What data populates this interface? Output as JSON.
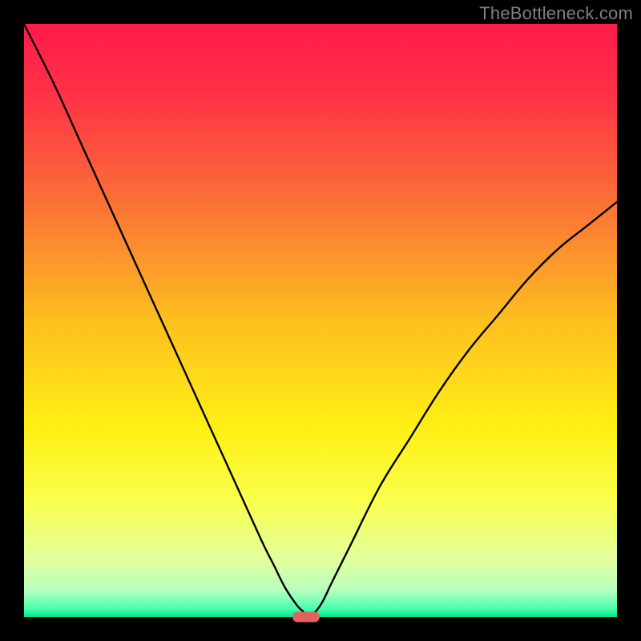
{
  "watermark": "TheBottleneck.com",
  "chart_data": {
    "type": "line",
    "title": "",
    "xlabel": "",
    "ylabel": "",
    "xlim": [
      0,
      100
    ],
    "ylim": [
      0,
      100
    ],
    "grid": false,
    "legend": false,
    "series": [
      {
        "name": "curve",
        "x": [
          0,
          5,
          10,
          15,
          20,
          25,
          30,
          35,
          40,
          42,
          44,
          46,
          47,
          48,
          50,
          52,
          55,
          60,
          65,
          70,
          75,
          80,
          85,
          90,
          95,
          100
        ],
        "values": [
          100,
          90,
          79,
          68,
          57,
          46,
          35,
          24,
          13,
          9,
          5,
          2,
          1,
          0,
          2,
          6,
          12,
          22,
          30,
          38,
          45,
          51,
          57,
          62,
          66,
          70
        ]
      }
    ],
    "marker": {
      "x": 47.5,
      "y": 0
    },
    "gradient_stops": [
      {
        "offset": 0.0,
        "color": "#ff1b4b"
      },
      {
        "offset": 0.12,
        "color": "#ff3246"
      },
      {
        "offset": 0.3,
        "color": "#fb7037"
      },
      {
        "offset": 0.5,
        "color": "#fdbf1f"
      },
      {
        "offset": 0.68,
        "color": "#ffef14"
      },
      {
        "offset": 0.8,
        "color": "#faff4a"
      },
      {
        "offset": 0.9,
        "color": "#e4ff9a"
      },
      {
        "offset": 0.955,
        "color": "#b7ffbf"
      },
      {
        "offset": 0.985,
        "color": "#4dffb0"
      },
      {
        "offset": 1.0,
        "color": "#00e78a"
      }
    ]
  }
}
